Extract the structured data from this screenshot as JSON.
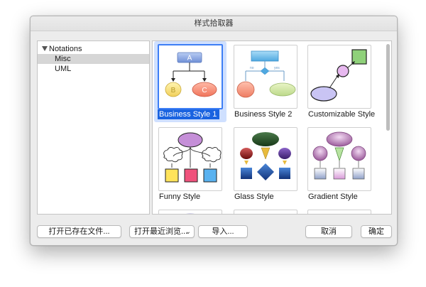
{
  "window": {
    "title": "样式拾取器"
  },
  "tree": {
    "root": "Notations",
    "items": [
      "Misc",
      "UML"
    ],
    "selected": "Misc"
  },
  "gallery": {
    "tiles": [
      {
        "label": "Business Style 1",
        "selected": true
      },
      {
        "label": "Business Style 2"
      },
      {
        "label": "Customizable Style"
      },
      {
        "label": "Funny Style"
      },
      {
        "label": "Glass Style"
      },
      {
        "label": "Gradient Style"
      }
    ],
    "thumb_text": {
      "node_a": "A",
      "node_b": "B",
      "node_c": "C",
      "no": "no",
      "yes": "yes"
    }
  },
  "buttons": {
    "open_saved": "打开已存在文件...",
    "open_recent": "打开最近浏览...",
    "import": "导入...",
    "cancel": "取消",
    "ok": "确定"
  },
  "colors": {
    "accent": "#1a63e0",
    "selection_bg": "#cfe0ff"
  }
}
